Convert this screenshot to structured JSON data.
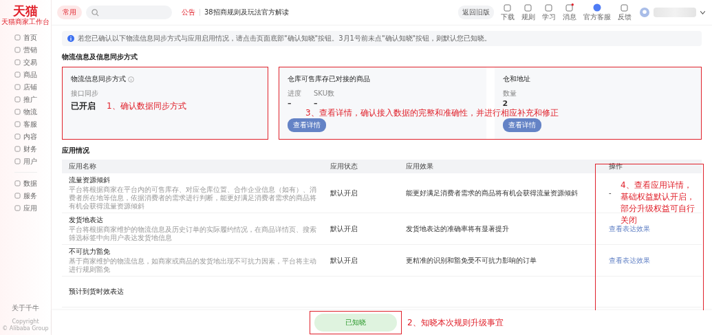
{
  "logo": {
    "title": "天猫",
    "subtitle": "天猫商家工作台"
  },
  "sidebar": {
    "items": [
      {
        "label": "首页"
      },
      {
        "label": "营销"
      },
      {
        "label": "交易"
      },
      {
        "label": "商品"
      },
      {
        "label": "店铺"
      },
      {
        "label": "推广"
      },
      {
        "label": "物流"
      },
      {
        "label": "客服"
      },
      {
        "label": "内容"
      },
      {
        "label": "财务"
      },
      {
        "label": "用户"
      }
    ],
    "more_items": [
      {
        "label": "数据"
      },
      {
        "label": "服务"
      },
      {
        "label": "应用"
      }
    ],
    "footer": [
      "关于千牛",
      "Copyright",
      "© Alibaba Group"
    ]
  },
  "topbar": {
    "frequent": "常用",
    "notice_label": "公告",
    "notice": "38招商规则及玩法官方解读",
    "back_button": "返回旧版",
    "tools": [
      {
        "label": "下载",
        "badge": false
      },
      {
        "label": "规则",
        "badge": false
      },
      {
        "label": "学习",
        "badge": false
      },
      {
        "label": "消息",
        "badge": true
      },
      {
        "label": "官方客服",
        "badge": false
      },
      {
        "label": "反馈",
        "badge": false
      }
    ]
  },
  "info": "若您已确认以下物流信息同步方式与应用启用情况，请点击页面底部\"确认知晓\"按钮。3月1号前未点\"确认知晓\"按钮，则默认您已知晓。",
  "sync_section": {
    "title": "物流信息及信息同步方式",
    "sync_card": {
      "title": "物流信息同步方式",
      "label": "接口同步",
      "value": "已开启"
    },
    "goods_card": {
      "title": "仓库可售库存已对接的商品",
      "stats": [
        {
          "label": "进度",
          "value": "–"
        },
        {
          "label": "SKU数",
          "value": "–"
        }
      ],
      "button": "查看详情"
    },
    "warehouse_card": {
      "title": "仓和地址",
      "stats": [
        {
          "label": "数量",
          "value": "2"
        }
      ],
      "button": "查看详情"
    }
  },
  "app_section": {
    "title": "应用情况",
    "columns": [
      "应用名称",
      "应用状态",
      "应用效果",
      "操作"
    ],
    "rows": [
      {
        "name": "流量资源倾斜",
        "desc": "平台将根据商家在平台内的可售库存、对应仓库位置、合作企业信息（如有）、消费者所在地等信息，依据消费者的需求进行判断，能更好满足消费者需求的商品将有机会获得流量资源倾斜",
        "status": "默认开启",
        "effect": "能更好满足消费者需求的商品将有机会获得流量资源倾斜",
        "action": "-",
        "kind": "plain"
      },
      {
        "name": "发货地表达",
        "desc": "平台将根据商家维护的物流信息及历史订单的实际履约情况，在商品详情页、搜索筛选标签中向用户表达发货地信息",
        "status": "默认开启",
        "effect": "发货地表达的准确率将有显著提升",
        "action": "查看表达效果",
        "kind": "link"
      },
      {
        "name": "不可抗力豁免",
        "desc": "基于商家维护的物流信息，如商家或商品的发货地出现不可抗力因素，平台将主动进行规则豁免",
        "status": "默认开启",
        "effect": "更精准的识别和豁免受不可抗力影响的订单",
        "action": "查看表达效果",
        "kind": "link"
      },
      {
        "name": "预计到货时效表达"
      }
    ]
  },
  "confirm_button": "已知晓",
  "annotations": [
    {
      "text": "1、确认数据同步方式"
    },
    {
      "text": "3、查看详情，确认接入数据的完整和准确性，并进行相应补充和修正"
    },
    {
      "text": "4、查看应用详情，基础权益默认开启，部分升级权益可自行关闭"
    },
    {
      "text": "2、知晓本次规则升级事宜"
    }
  ]
}
